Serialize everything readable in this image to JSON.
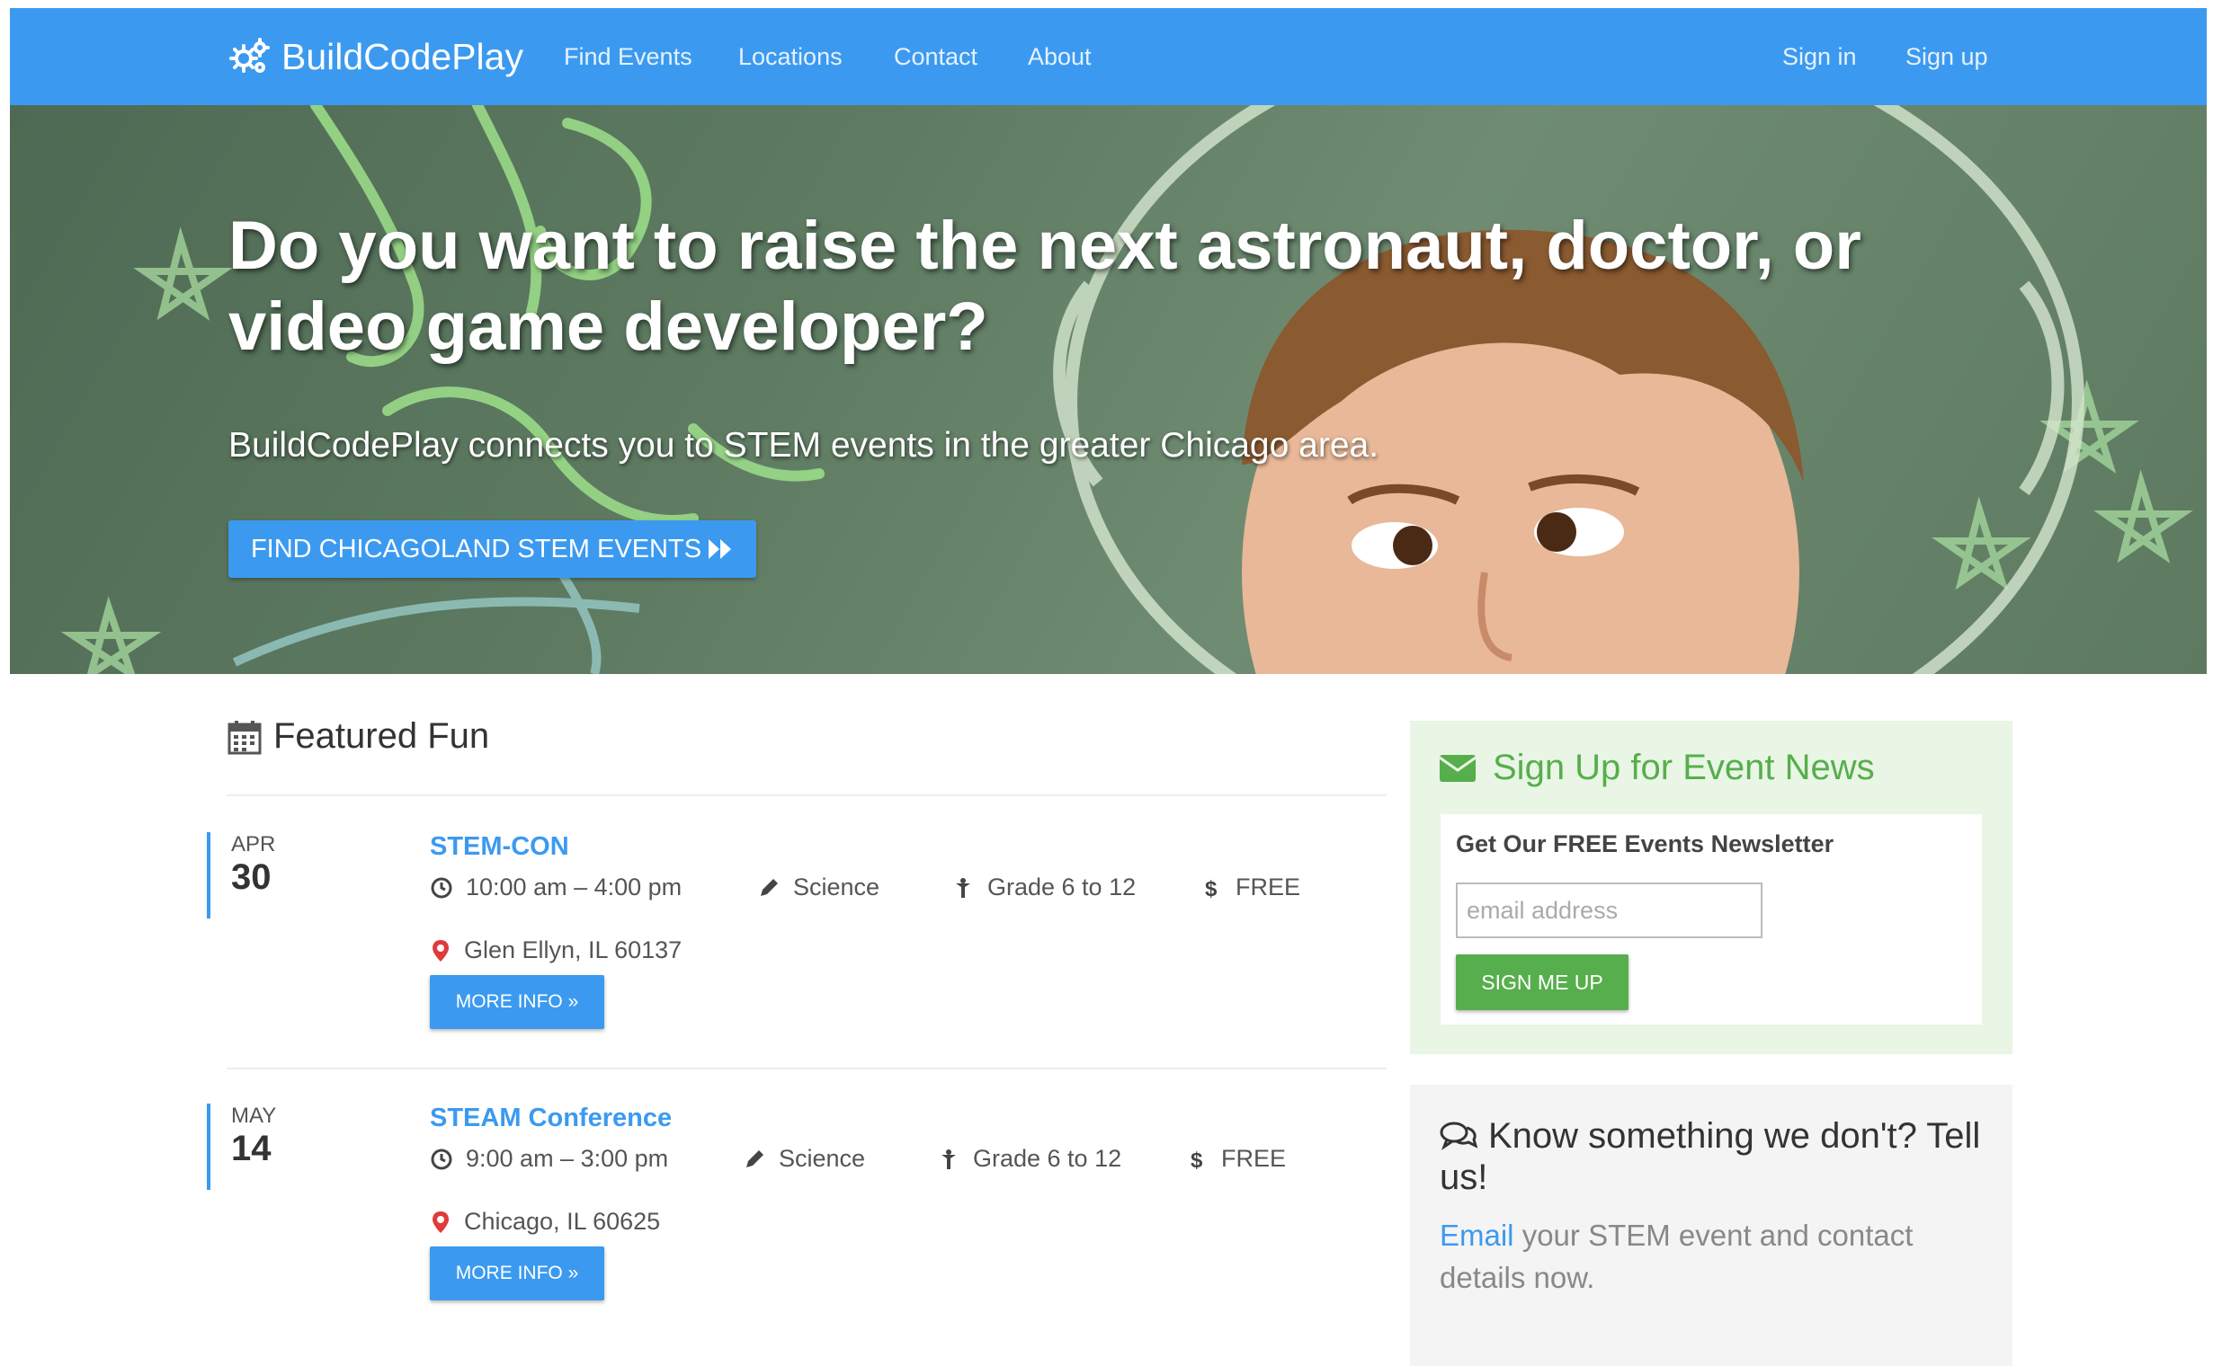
{
  "navbar": {
    "brand": "BuildCodePlay",
    "brand_icon": "gears-icon",
    "links": [
      {
        "label": "Find Events"
      },
      {
        "label": "Locations"
      },
      {
        "label": "Contact"
      },
      {
        "label": "About"
      }
    ],
    "auth": [
      {
        "label": "Sign in"
      },
      {
        "label": "Sign up"
      }
    ],
    "color": "#3b9af0"
  },
  "hero": {
    "title": "Do you want to raise the next astronaut, doctor, or video game developer?",
    "subtitle": "BuildCodePlay connects you to STEM events in the greater Chicago area.",
    "cta_label": "FIND CHICAGOLAND STEM EVENTS",
    "cta_icon": "fast-forward-icon"
  },
  "featured": {
    "heading": "Featured Fun",
    "heading_icon": "calendar-icon",
    "events": [
      {
        "month": "APR",
        "day": "30",
        "title": "STEM-CON",
        "time": "10:00 am – 4:00 pm",
        "subject": "Science",
        "grade": "Grade 6 to 12",
        "price": "FREE",
        "location": "Glen Ellyn,  IL  60137",
        "button": "MORE INFO »"
      },
      {
        "month": "MAY",
        "day": "14",
        "title": "STEAM Conference",
        "time": "9:00 am – 3:00 pm",
        "subject": "Science",
        "grade": "Grade 6 to 12",
        "price": "FREE",
        "location": "Chicago,  IL  60625",
        "button": "MORE INFO »"
      }
    ]
  },
  "newsletter": {
    "title": "Sign Up for Event News",
    "title_icon": "envelope-icon",
    "label": "Get Our FREE Events Newsletter",
    "email_placeholder": "email address",
    "email_value": "",
    "button": "SIGN ME UP",
    "accent": "#57ae4c"
  },
  "tellus": {
    "title": "Know something we don't? Tell us!",
    "title_icon": "comments-icon",
    "link": "Email",
    "text": " your STEM event and contact details now."
  }
}
